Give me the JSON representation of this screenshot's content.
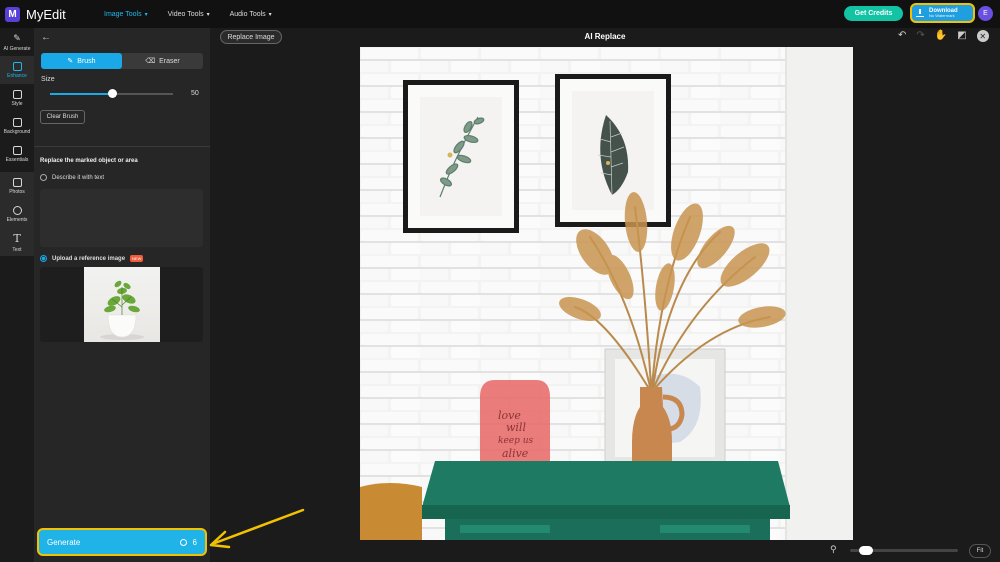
{
  "header": {
    "app_name": "MyEdit",
    "nav": [
      {
        "label": "Image Tools",
        "active": true
      },
      {
        "label": "Video Tools",
        "active": false
      },
      {
        "label": "Audio Tools",
        "active": false
      }
    ],
    "credits_label": "Get Credits",
    "download_label": "Download",
    "download_sublabel": "No Watermark",
    "avatar_initial": "E",
    "accent": "#1fb8ec",
    "highlight": "#f2c200"
  },
  "rail": {
    "items": [
      {
        "label": "AI Generate",
        "icon": "magic-wand-icon"
      },
      {
        "label": "Enhance",
        "icon": "enhance-icon"
      },
      {
        "label": "Style",
        "icon": "style-icon"
      },
      {
        "label": "Background",
        "icon": "background-icon"
      },
      {
        "label": "Essentials",
        "icon": "essentials-icon"
      },
      {
        "label": "Photos",
        "icon": "photo-icon"
      },
      {
        "label": "Elements",
        "icon": "shapes-icon"
      },
      {
        "label": "Text",
        "icon": "text-icon"
      }
    ]
  },
  "panel": {
    "brush_label": "Brush",
    "eraser_label": "Eraser",
    "size_label": "Size",
    "size_value": "50",
    "size_fraction": 0.5,
    "clear_label": "Clear Brush",
    "section_title": "Replace the marked object or area",
    "option_text_label": "Describe it with text",
    "option_image_label": "Upload a reference image",
    "new_badge": "NEW",
    "generate_label": "Generate",
    "generate_cost": "6"
  },
  "workspace": {
    "replace_label": "Replace Image",
    "title": "AI Replace",
    "fit_label": "Fit",
    "zoom_fraction": 0.08
  },
  "canvas_text": {
    "frame_quote_l1": "love",
    "frame_quote_l2": "will",
    "frame_quote_l3": "keep us",
    "frame_quote_l4": "alive"
  }
}
